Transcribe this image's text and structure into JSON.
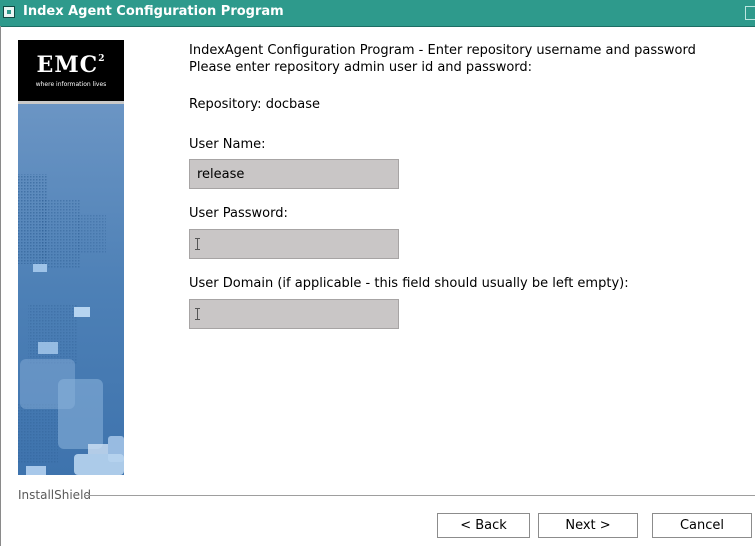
{
  "window": {
    "title": "Index Agent Configuration Program"
  },
  "branding": {
    "logo_text": "EMC",
    "logo_superscript": "2",
    "tagline": "where information lives"
  },
  "content": {
    "heading_line1": "IndexAgent Configuration Program - Enter repository username and password",
    "heading_line2": "Please enter repository admin user id and password:",
    "repository_label": "Repository: docbase",
    "user_name_label": "User Name:",
    "user_name_value": "release",
    "user_password_label": "User Password:",
    "user_password_value": "",
    "user_domain_label": "User Domain (if applicable - this field should usually be left empty):",
    "user_domain_value": ""
  },
  "footer": {
    "installer_label": "InstallShield",
    "back_label": "< Back",
    "next_label": "Next >",
    "cancel_label": "Cancel"
  },
  "colors": {
    "titlebar": "#2e9a8c",
    "field_background": "#c9c6c6",
    "panel_blue": "#5a8bbe"
  },
  "icons": {
    "window_menu": "window-menu-icon",
    "maximize": "maximize-icon",
    "text_cursor": "i-beam-cursor-icon"
  }
}
